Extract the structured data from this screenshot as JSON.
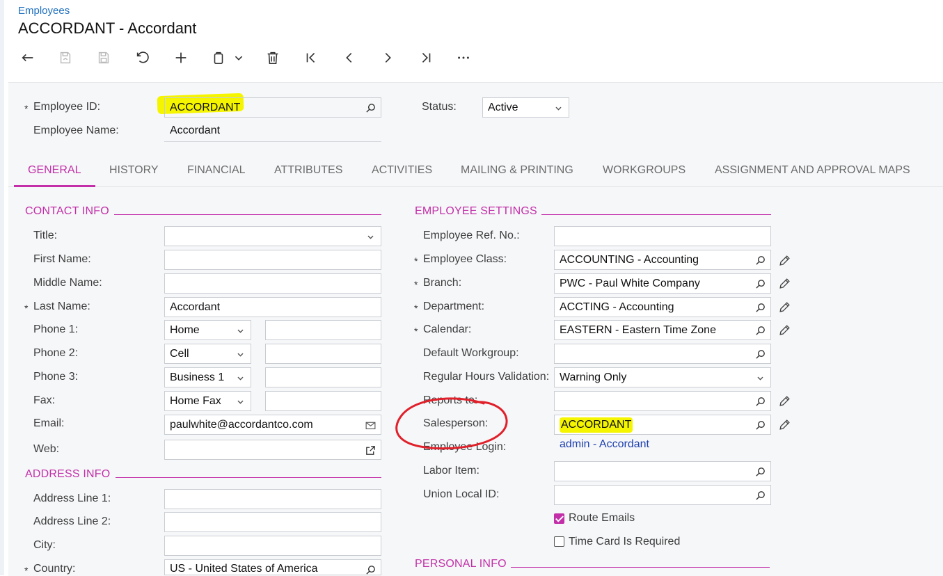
{
  "breadcrumb": "Employees",
  "title": "ACCORDANT - Accordant",
  "toolbar": {
    "icons": [
      "undo-back-icon",
      "save-close-icon",
      "save-icon",
      "revert-icon",
      "add-icon",
      "copy-paste-icon",
      "chevron-down-icon",
      "delete-icon",
      "first-record-icon",
      "previous-record-icon",
      "next-record-icon",
      "last-record-icon",
      "more-icon"
    ]
  },
  "header": {
    "employee_id_label": "Employee ID:",
    "employee_id_value": "ACCORDANT",
    "employee_name_label": "Employee Name:",
    "employee_name_value": "Accordant",
    "status_label": "Status:",
    "status_value": "Active"
  },
  "tabs": [
    {
      "label": "GENERAL"
    },
    {
      "label": "HISTORY"
    },
    {
      "label": "FINANCIAL"
    },
    {
      "label": "ATTRIBUTES"
    },
    {
      "label": "ACTIVITIES"
    },
    {
      "label": "MAILING & PRINTING"
    },
    {
      "label": "WORKGROUPS"
    },
    {
      "label": "ASSIGNMENT AND APPROVAL MAPS"
    }
  ],
  "contact": {
    "section_title": "CONTACT INFO",
    "title_label": "Title:",
    "title_value": "",
    "first_name_label": "First Name:",
    "first_name_value": "",
    "middle_name_label": "Middle Name:",
    "middle_name_value": "",
    "last_name_label": "Last Name:",
    "last_name_value": "Accordant",
    "phone1_label": "Phone 1:",
    "phone1_type": "Home",
    "phone1_value": "",
    "phone2_label": "Phone 2:",
    "phone2_type": "Cell",
    "phone2_value": "",
    "phone3_label": "Phone 3:",
    "phone3_type": "Business 1",
    "phone3_value": "",
    "fax_label": "Fax:",
    "fax_type": "Home Fax",
    "fax_value": "",
    "email_label": "Email:",
    "email_value": "paulwhite@accordantco.com",
    "web_label": "Web:",
    "web_value": ""
  },
  "address": {
    "section_title": "ADDRESS INFO",
    "line1_label": "Address Line 1:",
    "line1_value": "",
    "line2_label": "Address Line 2:",
    "line2_value": "",
    "city_label": "City:",
    "city_value": "",
    "country_label": "Country:",
    "country_value": "US - United States of America"
  },
  "settings": {
    "section_title": "EMPLOYEE SETTINGS",
    "ref_label": "Employee Ref. No.:",
    "ref_value": "",
    "class_label": "Employee Class:",
    "class_value": "ACCOUNTING - Accounting",
    "branch_label": "Branch:",
    "branch_value": "PWC - Paul White Company",
    "department_label": "Department:",
    "department_value": "ACCTING - Accounting",
    "calendar_label": "Calendar:",
    "calendar_value": "EASTERN - Eastern Time Zone",
    "workgroup_label": "Default Workgroup:",
    "workgroup_value": "",
    "hours_label": "Regular Hours Validation:",
    "hours_value": "Warning Only",
    "reports_label": "Reports to:",
    "reports_value": "",
    "salesperson_label": "Salesperson:",
    "salesperson_value": "ACCORDANT",
    "login_label": "Employee Login:",
    "login_value": "admin - Accordant",
    "labor_label": "Labor Item:",
    "labor_value": "",
    "union_label": "Union Local ID:",
    "union_value": "",
    "route_emails_label": "Route Emails",
    "route_emails_checked": true,
    "timecard_label": "Time Card Is Required",
    "timecard_checked": false
  },
  "personal": {
    "section_title": "PERSONAL INFO"
  },
  "required_mark": "*",
  "colors": {
    "accent": "#c22fa8",
    "link": "#1f6fbf",
    "highlight": "#f5f500",
    "annotation": "#e0202a"
  }
}
